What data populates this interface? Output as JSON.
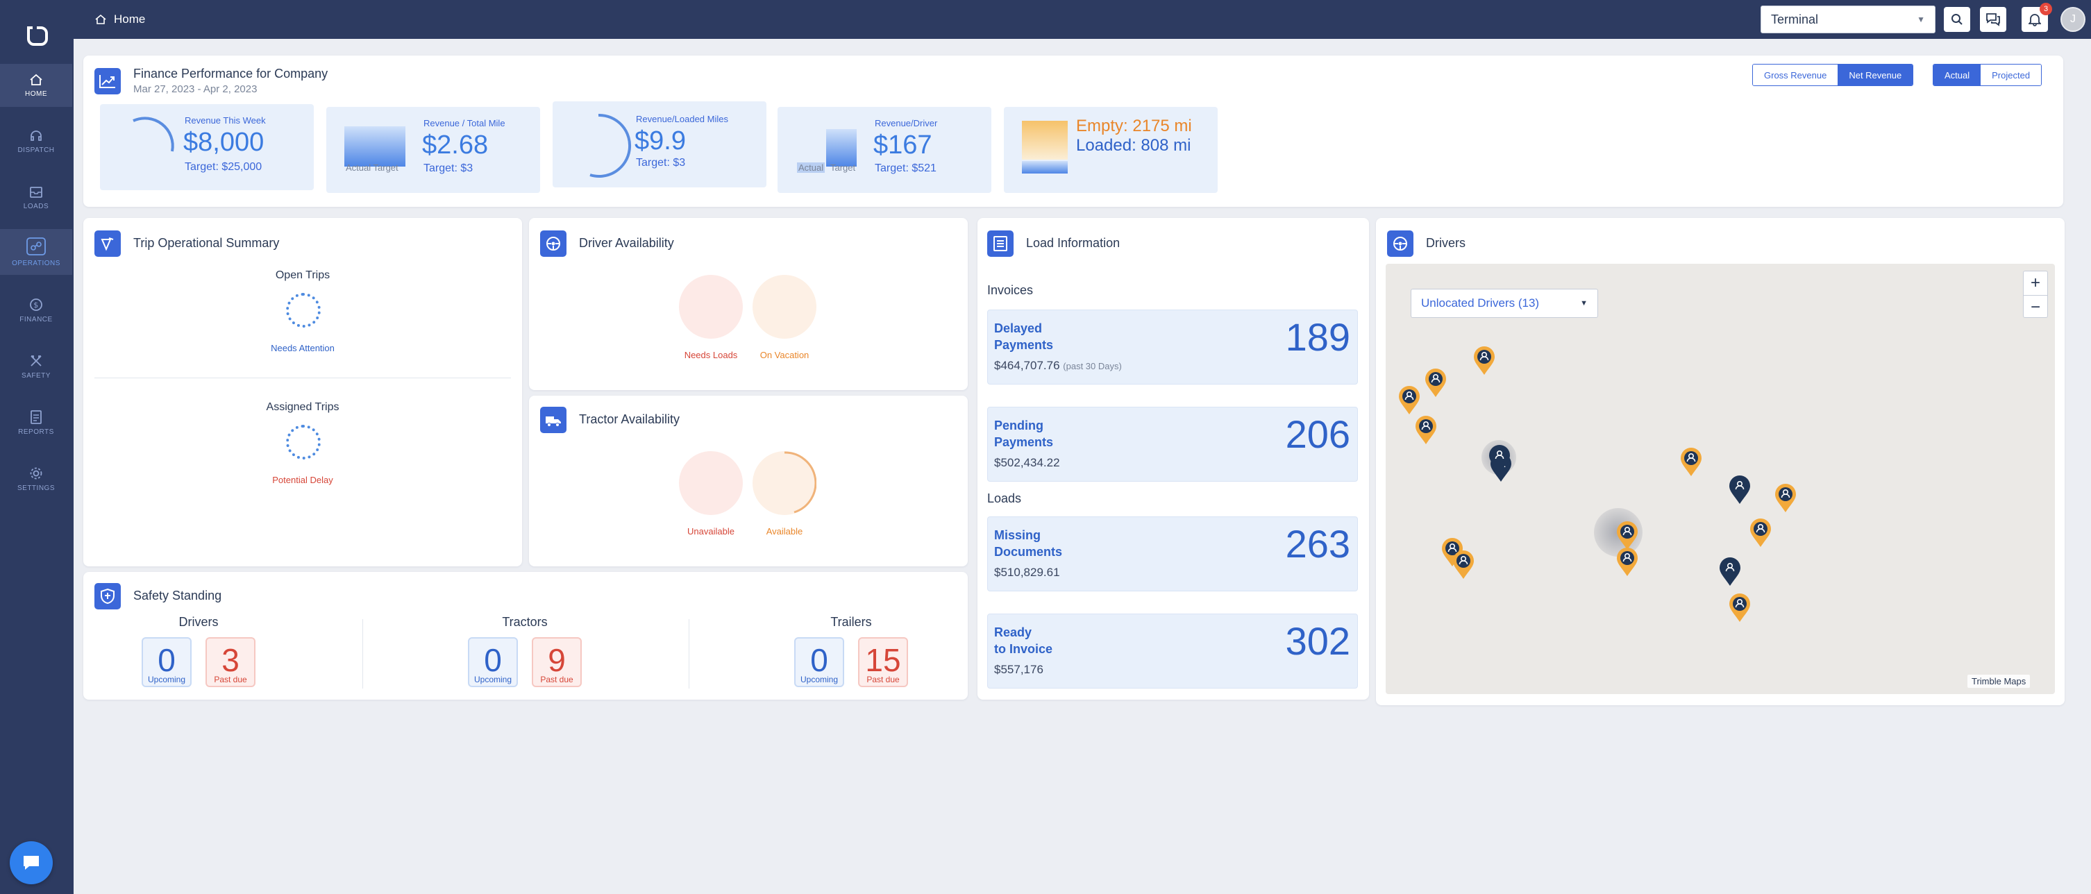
{
  "breadcrumb": {
    "label": "Home"
  },
  "header": {
    "terminal_select": "Terminal",
    "notification_count": "3",
    "avatar_initial": "J"
  },
  "sidebar": {
    "items": [
      {
        "label": "HOME",
        "icon": "home-icon"
      },
      {
        "label": "DISPATCH",
        "icon": "headset-icon"
      },
      {
        "label": "LOADS",
        "icon": "loads-icon"
      },
      {
        "label": "OPERATIONS",
        "icon": "operations-icon"
      },
      {
        "label": "FINANCE",
        "icon": "dollar-icon"
      },
      {
        "label": "SAFETY",
        "icon": "wrench-icon"
      },
      {
        "label": "REPORTS",
        "icon": "report-icon"
      },
      {
        "label": "SETTINGS",
        "icon": "gear-icon"
      }
    ]
  },
  "finance": {
    "title": "Finance Performance for Company",
    "date_range": "Mar 27, 2023 - Apr 2, 2023",
    "revenue_toggle": [
      "Gross Revenue",
      "Net Revenue"
    ],
    "revenue_active": "Net Revenue",
    "period_toggle": [
      "Actual",
      "Projected"
    ],
    "period_active": "Actual",
    "kpis": [
      {
        "label": "Revenue This Week",
        "value": "$8,000",
        "target": "Target: $25,000"
      },
      {
        "label": "Revenue / Total Mile",
        "value": "$2.68",
        "target": "Target: $3",
        "caption": "Actual Target"
      },
      {
        "label": "Revenue/Loaded Miles",
        "value": "$9.9",
        "target": "Target: $3"
      },
      {
        "label": "Revenue/Driver",
        "value": "$167",
        "target": "Target: $521",
        "caption_a": "Actual",
        "caption_b": "Target"
      },
      {
        "empty": "Empty: 2175 mi",
        "loaded": "Loaded: 808 mi"
      }
    ]
  },
  "trip_summary": {
    "title": "Trip Operational Summary",
    "open_trips": "Open Trips",
    "open_status": "Needs Attention",
    "assigned_trips": "Assigned Trips",
    "assigned_status": "Potential Delay"
  },
  "driver_availability": {
    "title": "Driver Availability",
    "labels": [
      "Needs Loads",
      "On Vacation"
    ]
  },
  "tractor_availability": {
    "title": "Tractor Availability",
    "labels": [
      "Unavailable",
      "Available"
    ]
  },
  "load_information": {
    "title": "Load Information",
    "invoices_heading": "Invoices",
    "loads_heading": "Loads",
    "items": [
      {
        "title_1": "Delayed",
        "title_2": "Payments",
        "count": "189",
        "amount": "$464,707.76",
        "note": "(past 30 Days)"
      },
      {
        "title_1": "Pending",
        "title_2": "Payments",
        "count": "206",
        "amount": "$502,434.22"
      },
      {
        "title_1": "Missing",
        "title_2": "Documents",
        "count": "263",
        "amount": "$510,829.61"
      },
      {
        "title_1": "Ready",
        "title_2": "to Invoice",
        "count": "302",
        "amount": "$557,176"
      }
    ]
  },
  "drivers_map": {
    "title": "Drivers",
    "filter": "Unlocated Drivers (13)",
    "attribution": "Trimble Maps",
    "colors": {
      "pin_orange": "#f2a93b",
      "pin_navy": "#1f3556"
    }
  },
  "safety": {
    "title": "Safety Standing",
    "groups": [
      {
        "name": "Drivers",
        "upcoming": "0",
        "past_due": "3"
      },
      {
        "name": "Tractors",
        "upcoming": "0",
        "past_due": "9"
      },
      {
        "name": "Trailers",
        "upcoming": "0",
        "past_due": "15"
      }
    ],
    "upcoming_label": "Upcoming",
    "past_due_label": "Past due"
  }
}
